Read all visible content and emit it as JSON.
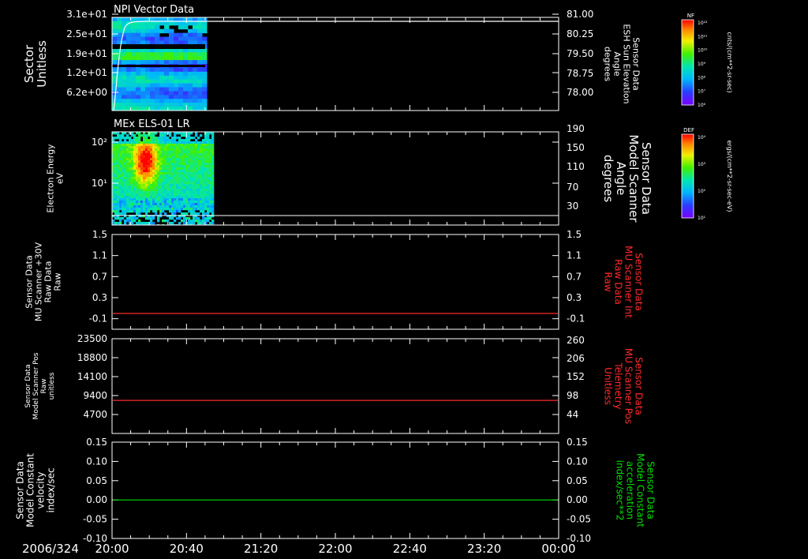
{
  "colors": {
    "white": "#ffffff",
    "red": "#ff2a2a",
    "green": "#00e000",
    "background": "#000000"
  },
  "time_axis": {
    "date": "2006/324",
    "labels": [
      "20:00",
      "20:40",
      "21:20",
      "22:00",
      "22:40",
      "23:20",
      "00:00"
    ]
  },
  "colorbars": [
    {
      "id": "nf",
      "top_label": "NF",
      "ticks": [
        "10¹²",
        "10¹¹",
        "10¹⁰",
        "10⁹",
        "10⁸",
        "10⁷",
        "10⁶"
      ],
      "units": "cnts/(cm**2-sr-sec)"
    },
    {
      "id": "def",
      "top_label": "DEF",
      "ticks": [
        "10⁴",
        "10³",
        "10²",
        "10¹"
      ],
      "units": "ergs/(cm**2-sr-sec-eV)"
    }
  ],
  "chart_data": [
    {
      "type": "heatmap",
      "title": "NPI Vector Data",
      "left_axis_label": [
        "Sector",
        "Unitless"
      ],
      "left_ticks": [
        "3.1e+01",
        "2.5e+01",
        "1.9e+01",
        "1.2e+01",
        "6.2e+00"
      ],
      "right_axis_label": [
        "Sensor Data",
        "ESH Sun Elevation",
        "Angle",
        "degrees"
      ],
      "right_ticks": [
        "81.00",
        "80.25",
        "79.50",
        "78.75",
        "78.00"
      ],
      "data_time_range": [
        "20:00",
        "20:50"
      ],
      "overlay_line": "sun elevation trace rising to 81.00"
    },
    {
      "type": "heatmap",
      "title": "MEx ELS-01 LR",
      "left_axis_label": [
        "Electron Energy",
        "eV"
      ],
      "left_ticks": [
        "10²",
        "10¹"
      ],
      "right_axis_label": [
        "Sensor Data",
        "Model Scanner",
        "Angle",
        "degrees"
      ],
      "right_ticks": [
        "190",
        "150",
        "110",
        "70",
        "30"
      ],
      "data_time_range": [
        "20:00",
        "20:52"
      ]
    },
    {
      "type": "line",
      "left_axis_label": [
        "Sensor Data",
        "MU Scanner +30V",
        "Raw Data",
        "Raw"
      ],
      "left_ticks": [
        "1.5",
        "1.1",
        "0.7",
        "0.3",
        "-0.1"
      ],
      "right_axis_label": [
        "Sensor Data",
        "MU Scanner Int",
        "Raw Data",
        "Raw"
      ],
      "right_ticks": [
        "1.5",
        "1.1",
        "0.7",
        "0.3",
        "-0.1"
      ],
      "ylim": [
        -0.3,
        1.5
      ],
      "series": [
        {
          "color": "#ff2a2a",
          "value": 0.0
        }
      ]
    },
    {
      "type": "line",
      "left_axis_label": [
        "Sensor Data",
        "Model Scanner Pos",
        "Raw",
        "unitless"
      ],
      "left_ticks": [
        "23500",
        "18800",
        "14100",
        "9400",
        "4700"
      ],
      "right_axis_label": [
        "Sensor Data",
        "MU Scanner Pos",
        "Telemetry",
        "Unitless"
      ],
      "right_ticks": [
        "260",
        "206",
        "152",
        "98",
        "44"
      ],
      "ylim": [
        0,
        23500
      ],
      "series": [
        {
          "color": "#ff2a2a",
          "value": 8200
        }
      ]
    },
    {
      "type": "line",
      "left_axis_label": [
        "Sensor Data",
        "Model Constant",
        "velocity",
        "index/sec"
      ],
      "left_ticks": [
        "0.15",
        "0.10",
        "0.05",
        "0.00",
        "-0.05",
        "-0.10"
      ],
      "right_axis_label": [
        "Sensor Data",
        "Model Constant",
        "acceleration",
        "index/sec**2"
      ],
      "right_ticks": [
        "0.15",
        "0.10",
        "0.05",
        "0.00",
        "-0.05",
        "-0.10"
      ],
      "ylim": [
        -0.1,
        0.15
      ],
      "series": [
        {
          "color": "#00e000",
          "value": 0.0
        }
      ]
    }
  ]
}
